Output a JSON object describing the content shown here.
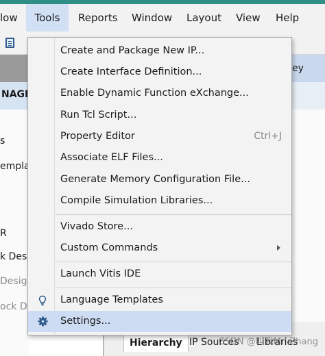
{
  "menubar": {
    "items": [
      {
        "label": "low",
        "active": false
      },
      {
        "label": "Tools",
        "active": true
      },
      {
        "label": "Reports",
        "active": false
      },
      {
        "label": "Window",
        "active": false
      },
      {
        "label": "Layout",
        "active": false
      },
      {
        "label": "View",
        "active": false
      },
      {
        "label": "Help",
        "active": false
      }
    ]
  },
  "left_panel": {
    "title": "NAGEI",
    "items": [
      "s",
      "empla",
      "R",
      "k Desi",
      "Desig",
      "ock De"
    ]
  },
  "right_panel": {
    "header": "ey"
  },
  "tools_menu": {
    "items": [
      {
        "label": "Create and Package New IP...",
        "shortcut": "",
        "submenu": false,
        "icon": ""
      },
      {
        "label": "Create Interface Definition...",
        "shortcut": "",
        "submenu": false,
        "icon": ""
      },
      {
        "label": "Enable Dynamic Function eXchange...",
        "shortcut": "",
        "submenu": false,
        "icon": ""
      },
      {
        "label": "Run Tcl Script...",
        "shortcut": "",
        "submenu": false,
        "icon": ""
      },
      {
        "label": "Property Editor",
        "shortcut": "Ctrl+J",
        "submenu": false,
        "icon": ""
      },
      {
        "label": "Associate ELF Files...",
        "shortcut": "",
        "submenu": false,
        "icon": ""
      },
      {
        "label": "Generate Memory Configuration File...",
        "shortcut": "",
        "submenu": false,
        "icon": ""
      },
      {
        "label": "Compile Simulation Libraries...",
        "shortcut": "",
        "submenu": false,
        "icon": ""
      },
      {
        "label": "Vivado Store...",
        "shortcut": "",
        "submenu": false,
        "icon": ""
      },
      {
        "label": "Custom Commands",
        "shortcut": "",
        "submenu": true,
        "icon": ""
      },
      {
        "label": "Launch Vitis IDE",
        "shortcut": "",
        "submenu": false,
        "icon": ""
      },
      {
        "label": "Language Templates",
        "shortcut": "",
        "submenu": false,
        "icon": "lightbulb-icon"
      },
      {
        "label": "Settings...",
        "shortcut": "",
        "submenu": false,
        "icon": "gear-icon",
        "highlighted": true
      }
    ]
  },
  "bottom_tabs": [
    {
      "label": "Hierarchy",
      "active": true
    },
    {
      "label": "IP Sources",
      "active": false
    },
    {
      "label": "Libraries",
      "active": false
    }
  ],
  "watermark": "CSDN @叫我Mr. Zhang",
  "colors": {
    "accent_stripe": "#2f8f86",
    "menu_highlight": "#cddcf3",
    "active_menu": "#d2e0f5",
    "icon_blue": "#2d5a8a"
  }
}
